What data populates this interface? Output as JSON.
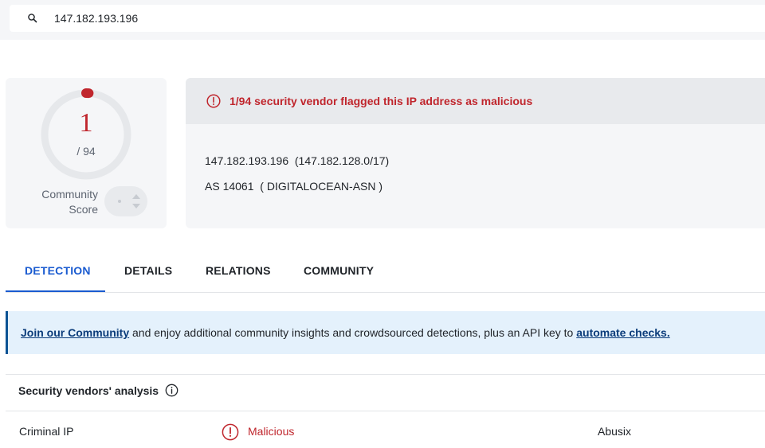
{
  "search": {
    "value": "147.182.193.196",
    "icon": "search-icon"
  },
  "score": {
    "detections": "1",
    "total": "/ 94",
    "community_label_line1": "Community",
    "community_label_line2": "Score",
    "ring_color": "#c0262d",
    "ring_fraction": 0.0106
  },
  "summary": {
    "alert_text": "1/94 security vendor flagged this IP address as malicious",
    "alert_icon": "alert-circle-icon",
    "ip_line": "147.182.193.196  (147.182.128.0/17)",
    "as_line": "AS 14061  ( DIGITALOCEAN-ASN )"
  },
  "tabs": [
    {
      "label": "DETECTION",
      "active": true
    },
    {
      "label": "DETAILS",
      "active": false
    },
    {
      "label": "RELATIONS",
      "active": false
    },
    {
      "label": "COMMUNITY",
      "active": false
    }
  ],
  "banner": {
    "link1": "Join our Community",
    "middle": " and enjoy additional community insights and crowdsourced detections, plus an API key to ",
    "link2": "automate checks."
  },
  "vendors": {
    "title": "Security vendors' analysis",
    "rows": [
      {
        "vendor": "Criminal IP",
        "result": "Malicious",
        "result_icon": "alert-circle-icon",
        "next_vendor": "Abusix"
      }
    ]
  },
  "colors": {
    "accent": "#1a5bd0",
    "danger": "#c0262d",
    "banner_bg": "#e4f1fc"
  }
}
